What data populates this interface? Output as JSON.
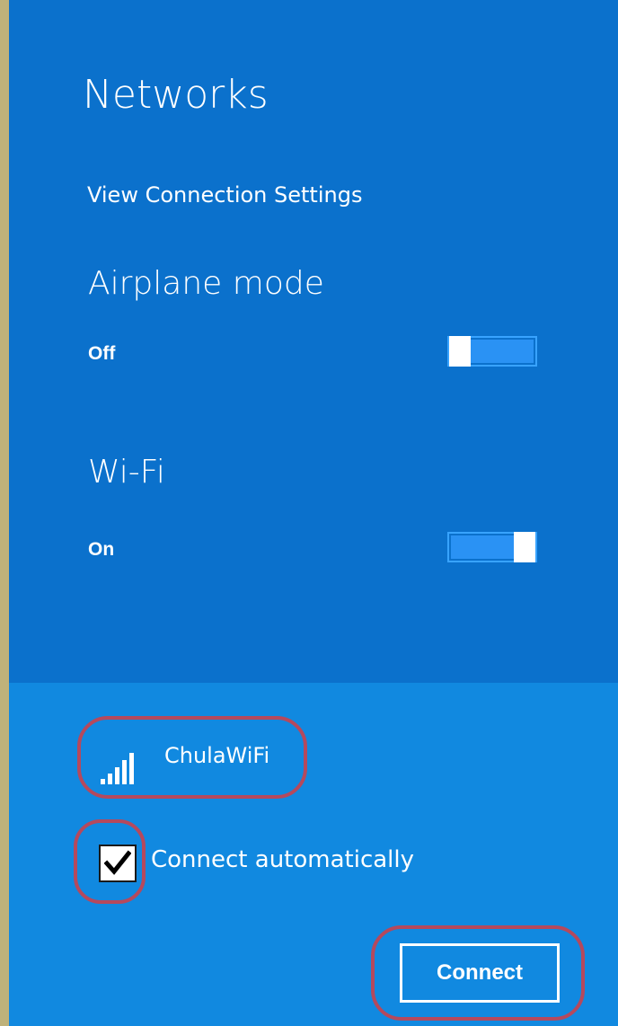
{
  "panel": {
    "title": "Networks",
    "view_settings_link": "View Connection Settings"
  },
  "airplane_mode": {
    "heading": "Airplane mode",
    "state_label": "Off",
    "enabled": false
  },
  "wifi": {
    "heading": "Wi-Fi",
    "state_label": "On",
    "enabled": true
  },
  "network": {
    "ssid": "ChulaWiFi",
    "signal_icon": "wifi-signal-bars-icon",
    "signal_bars": 5
  },
  "auto_connect": {
    "label": "Connect automatically",
    "checked": true
  },
  "connect_button": {
    "label": "Connect"
  },
  "colors": {
    "panel_top": "#0b71cc",
    "panel_bottom": "#1189e0",
    "highlight_ring": "#b5495d",
    "text": "#ffffff"
  }
}
